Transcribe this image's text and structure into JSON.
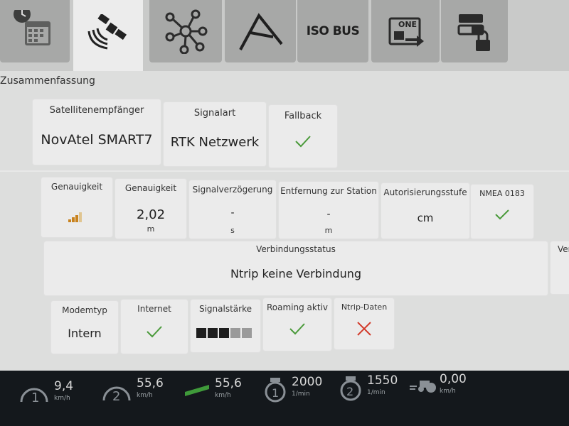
{
  "page_title": "Zusammenfassung",
  "tabs": [
    {
      "icon": "calendar-clock-icon"
    },
    {
      "icon": "satellite-icon",
      "active": true
    },
    {
      "icon": "network-hub-icon"
    },
    {
      "icon": "boundary-angle-icon"
    },
    {
      "icon": "isobus-icon",
      "text": "ISO BUS"
    },
    {
      "icon": "one-transfer-icon",
      "text": "ONE"
    },
    {
      "icon": "lock-settings-icon"
    }
  ],
  "summary": {
    "receiver": {
      "label": "Satellitenempfänger",
      "value": "NovAtel SMART7"
    },
    "signal_type": {
      "label": "Signalart",
      "value": "RTK Netzwerk"
    },
    "fallback": {
      "label": "Fallback",
      "status": "check"
    }
  },
  "accuracy": {
    "accuracy_icon": {
      "label": "Genauigkeit",
      "icon": "signal-bars-icon"
    },
    "accuracy_value": {
      "label": "Genauigkeit",
      "value": "2,02",
      "unit": "m"
    },
    "signal_delay": {
      "label": "Signalverzögerung",
      "value": "-",
      "unit": "s"
    },
    "station_distance": {
      "label": "Entfernung zur Station",
      "value": "-",
      "unit": "m"
    },
    "authorization": {
      "label": "Autorisierungsstufe",
      "value": "cm"
    },
    "nmea": {
      "label": "NMEA 0183",
      "status": "check"
    }
  },
  "connection": {
    "label": "Verbindungsstatus",
    "value": "Ntrip keine Verbindung",
    "cut_label": "Ver"
  },
  "modem": {
    "modem_type": {
      "label": "Modemtyp",
      "value": "Intern"
    },
    "internet": {
      "label": "Internet",
      "status": "check"
    },
    "signal_strength": {
      "label": "Signalstärke",
      "bars_filled": 3,
      "bars_total": 5
    },
    "roaming": {
      "label": "Roaming aktiv",
      "status": "check"
    },
    "ntrip_data": {
      "label": "Ntrip-Daten",
      "status": "cross"
    }
  },
  "status_bar": [
    {
      "icon": "speed-1-icon",
      "value": "9,4",
      "unit": "km/h"
    },
    {
      "icon": "speed-2-icon",
      "value": "55,6",
      "unit": "km/h"
    },
    {
      "icon": "ground-speed-icon",
      "value": "55,6",
      "unit": "km/h"
    },
    {
      "icon": "pto-1-icon",
      "value": "2000",
      "unit": "1/min"
    },
    {
      "icon": "pto-2-icon",
      "value": "1550",
      "unit": "1/min"
    },
    {
      "icon": "wheel-slip-icon",
      "value": "0,00",
      "unit": "km/h"
    }
  ],
  "colors": {
    "check": "#4a9a3a",
    "cross": "#d23a2a",
    "bars": "#c8821e"
  }
}
